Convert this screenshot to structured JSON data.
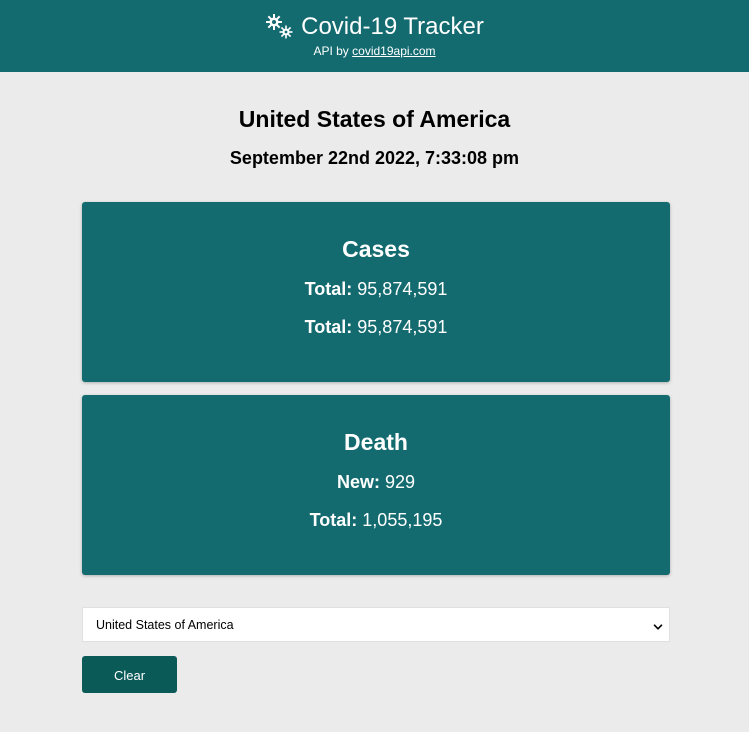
{
  "header": {
    "title": "Covid-19 Tracker",
    "api_prefix": "API by",
    "api_link": "covid19api.com",
    "logo_icon": "virus-icon"
  },
  "country": {
    "name": "United States of America",
    "datetime": "September 22nd 2022, 7:33:08 pm"
  },
  "cards": {
    "cases": {
      "title": "Cases",
      "row1_label": "Total:",
      "row1_value": "95,874,591",
      "row2_label": "Total:",
      "row2_value": "95,874,591"
    },
    "death": {
      "title": "Death",
      "row1_label": "New:",
      "row1_value": "929",
      "row2_label": "Total:",
      "row2_value": "1,055,195"
    }
  },
  "country_select": {
    "selected": "United States of America"
  },
  "clear_button": {
    "label": "Clear"
  },
  "colors": {
    "primary": "#136b70",
    "button": "#0a5a58",
    "background": "#ebebeb"
  }
}
